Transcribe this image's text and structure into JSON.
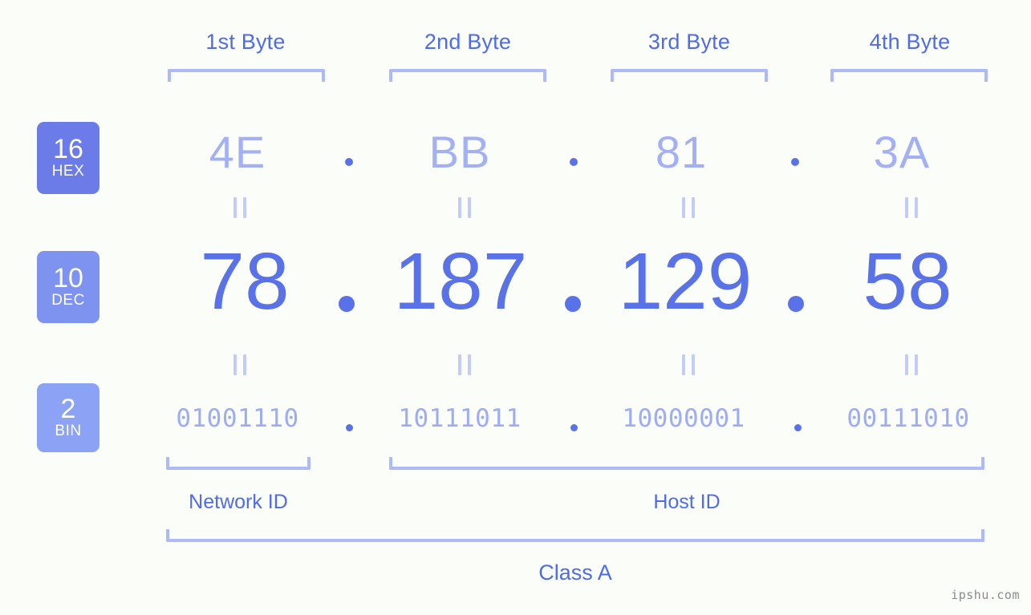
{
  "headers": [
    {
      "label": "1st Byte"
    },
    {
      "label": "2nd Byte"
    },
    {
      "label": "3rd Byte"
    },
    {
      "label": "4th Byte"
    }
  ],
  "badges": [
    {
      "num": "16",
      "abbr": "HEX"
    },
    {
      "num": "10",
      "abbr": "DEC"
    },
    {
      "num": "2",
      "abbr": "BIN"
    }
  ],
  "rows": {
    "hex": {
      "values": [
        "4E",
        "BB",
        "81",
        "3A"
      ]
    },
    "dec": {
      "values": [
        "78",
        "187",
        "129",
        "58"
      ]
    },
    "bin": {
      "values": [
        "01001110",
        "10111011",
        "10000001",
        "00111010"
      ]
    }
  },
  "separator": ".",
  "connector": "=",
  "segments": {
    "network_id": "Network ID",
    "host_id": "Host ID"
  },
  "class_label": "Class A",
  "watermark": "ipshu.com",
  "colors": {
    "background": "#FBFDF9",
    "accent_strong": "#5A72E8",
    "accent_label": "#4F6BE8",
    "accent_light": "#A3B0F4",
    "bracket": "#AEBAF7",
    "badge_hex": "#6B7BE8",
    "badge_dec": "#7E92F0",
    "badge_bin": "#8CA3F5",
    "watermark": "#8A8A8A"
  }
}
